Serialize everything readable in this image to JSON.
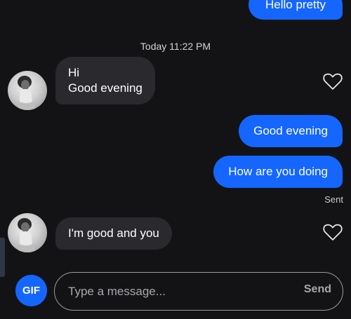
{
  "messages": {
    "top_outgoing": "Hello pretty",
    "timestamp": "Today 11:22 PM",
    "incoming_1": [
      "Hi",
      "Good evening"
    ],
    "outgoing_1": "Good evening",
    "outgoing_2": "How are you doing",
    "sent_status": "Sent",
    "incoming_2": "I'm good and you"
  },
  "composer": {
    "gif_label": "GIF",
    "placeholder": "Type a message...",
    "send_label": "Send"
  },
  "icons": {
    "like": "heart-outline-icon"
  },
  "colors": {
    "background": "#131316",
    "outgoing_bubble": "#1566ff",
    "incoming_bubble": "#2a2a2e"
  }
}
